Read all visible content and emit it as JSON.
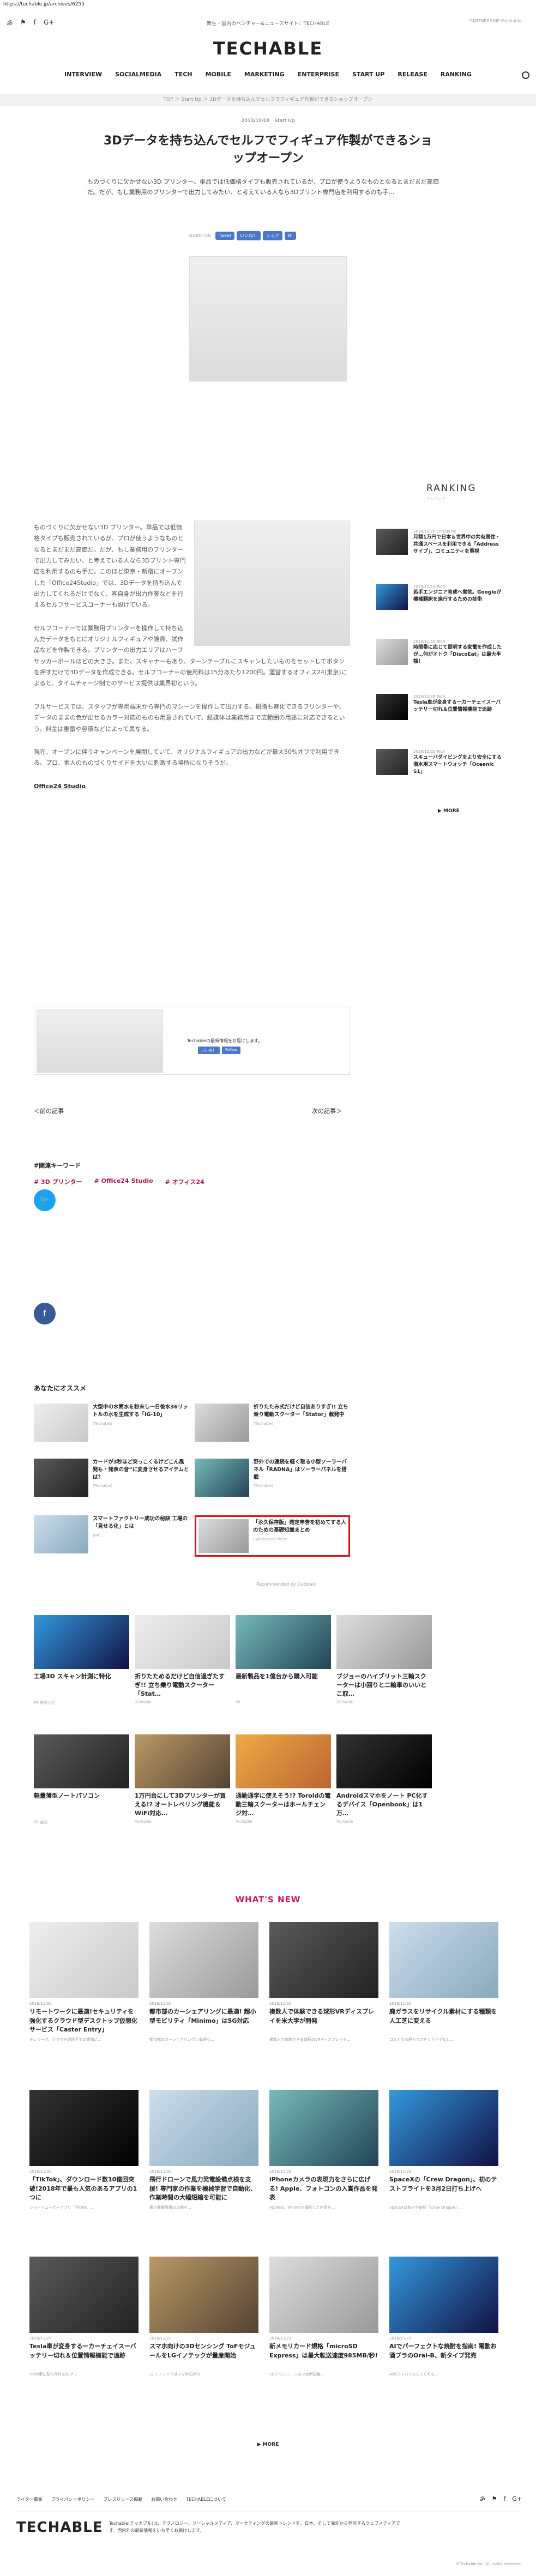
{
  "url": "https://techable.jp/archives/6255",
  "header": {
    "tagline": "新生・国内のベンチャー&ニュースサイト：TECHABLE",
    "partner": "PARTNERSHIP  Mashable",
    "logo": "TECHABLE",
    "social": [
      "ॐ",
      "⚑",
      "f",
      "G+"
    ],
    "nav": [
      "INTERVIEW",
      "SOCIALMEDIA",
      "TECH",
      "MOBILE",
      "MARKETING",
      "ENTERPRISE",
      "START UP",
      "RELEASE",
      "RANKING"
    ]
  },
  "breadcrumb": "TOP ＞ Start Up ＞ 3Dデータを持ち込んでセルフでフィギュア作製ができるショップオープン",
  "article": {
    "meta": "2013/10/18　Start Up",
    "title": "3Dデータを持ち込んでセルフでフィギュア作製ができるショップオープン",
    "lead": "ものづくりに欠かせない3D プリンター。単品では低価格タイプも販売されているが、プロが使うようなものとなるとまだまだ高価だ。だが、もし業務用のプリンターで出力してみたい、と考えている人なら3Dプリント専門店を利用するのも手…",
    "share_label": "SHARE ON",
    "share_buttons": [
      "Tweet",
      "いいね！",
      "シェア",
      "B!"
    ],
    "paragraphs": [
      "ものづくりに欠かせない3D プリンター。単品では低価格タイプも販売されているが、プロが使うようなものとなるとまだまだ高価だ。だが、もし業務用のプリンターで出力してみたい、と考えている人なら3Dプリント専門店を利用するのも手だ。このほど東京・新宿にオープンした「Office24Studio」では、3Dデータを持ち込んで出力してくれるだけでなく、客自身が出力作業などを行えるセルフサービスコーナーも設けている。",
      "セルフコーナーでは業務用プリンターを操作して持ち込んだデータをもとにオリジナルフィギュアや雑貨、試作品などを作製できる。プリンターの出力エリアはハーフサッカーボールほどの大きさ。また、スキャナーもあり、ターンテーブルにスキャンしたいものをセットしてボタンを押すだけで3Dデータを作成できる。セルフコーナーの使用料は15分あたり1200円。運営するオフィス24(東京)によると、タイムチャージ制でのサービス提供は業界初という。",
      "フルサービスでは、スタッフが専用端末から専門のマシーンを操作して出力する。樹脂も進化できるプリンターや、データのままの色が出せるカラー対応のものも用意されていて、紙媒体は業務用まで広範囲の用途に対応できるという。料金は重量や容積などによって異なる。",
      "現在、オープンに伴うキャンペーンを展開していて、オリジナルフィギュアの出力などが最大50%オフで利用できる。プロ、素人のものづくりサイドを大いに刺激する場所になりそうだ。"
    ],
    "tag": "Office24 Studio",
    "promo_text": "Techableの最新情報をお届けします。",
    "promo_buttons": [
      "いいね！",
      "Follow"
    ],
    "prev": "＜前の記事",
    "next": "次の記事＞"
  },
  "ranking": {
    "title": "RANKING",
    "sub": "ランキング",
    "items": [
      {
        "date": "2018/11/26 Enterprise",
        "title": "月額1万円で日本＆世界中の共有居住・共通スペースを利用できる「Addressサイプ」、コミュニティを重視"
      },
      {
        "date": "2018/11/19 Tech",
        "title": "若手エンジニア育成へ意欲。Googleが機械翻訳を進行するための技術"
      },
      {
        "date": "2018/11/26 Tech",
        "title": "時間帯に応じて照明する家電を作成したが…何がオトク「DiscoEat」は最大半額！"
      },
      {
        "date": "2018/11/29 Tech",
        "title": "Tesla車が変身する一カーチェイスーバッテリー切れ＆位置情報機能で追跡"
      },
      {
        "date": "2018/11/20 Tech",
        "title": "スキューバダイビングをより安全にする潜水用スマートウォッチ「Oceanic S1」"
      }
    ],
    "more": "▶ MORE"
  },
  "related": {
    "heading": "#関連キーワード",
    "keywords": [
      "# 3D プリンター",
      "# Office24 Studio",
      "# オフィス24"
    ]
  },
  "recommend": {
    "heading": "あなたにオススメ",
    "items": [
      {
        "title": "大型中の水筒水を粉末し一日後水36リットルの水を生成する「IG-10」",
        "src": "(Techable)"
      },
      {
        "title": "折りたたみ式だけど自信ありすぎ!! 立ち乗り電動スクーター「Stator」載発中",
        "src": "(Techable)"
      },
      {
        "title": "カードが3秒ほど突っこくるけどこん風発も・発表の音“に変身させるアイテムとは？",
        "src": "(Techable)"
      },
      {
        "title": "野外での連続を軽く取る小型ソーラーパネル「RADNA」はソーラーパネルを搭載",
        "src": "(Techable)"
      },
      {
        "title": "スマートファクトリー成功の秘訣 工場の「見せる化」とは",
        "src": "(PR) ..."
      },
      {
        "title": "「永久保存版」確定申告を初めてする人のための基礎知識まとめ",
        "src": "(Sponsored) freee"
      }
    ],
    "outbrain": "Recommended by Outbrain"
  },
  "grid": [
    {
      "title": "工場3D スキャン計測に特化",
      "src": "PR 株式会社"
    },
    {
      "title": "折りたためるだけど自信過ぎたすぎ!! 立ち乗り電動スクーター「Stat…",
      "src": "Techable"
    },
    {
      "title": "最新製品を1億台から購入可能",
      "src": "PR"
    },
    {
      "title": "ブジョーのハイブリット三輪スクーターは小回りと二輪車のいいとこ取…",
      "src": "Techable"
    },
    {
      "title": "軽量薄型ノートパソコン",
      "src": "PR 会社"
    },
    {
      "title": "1万円台にして3Dプリンターが買える!? オートレベリング機能＆WiFi対応…",
      "src": "Techable"
    },
    {
      "title": "通勤通学に使えそう!? Toroidの電動三輪スクーターはホールチェンジ対…",
      "src": "Techable"
    },
    {
      "title": "Androidスマホをノート PC化するデバイス「Openbook」は1万…",
      "src": "Techable"
    }
  ],
  "whats_new": {
    "heading": "WHAT'S NEW",
    "items": [
      {
        "date": "2018/11/30",
        "title": "リモートワークに最適!セキュリティを強化するクラウド型デスクトップ仮想化サービス「Caster Entry」",
        "desc": "テレワーク、クラウド環境下での業務に…"
      },
      {
        "date": "2018/11/30",
        "title": "都市部のカーシェアリングに最適! 超小型モビリティ「Minimo」は5G対応",
        "desc": "都市部のカーシェアリングに最適な…"
      },
      {
        "date": "2018/11/30",
        "title": "複数人で体験できる球形VRディスプレイを米大学が開発",
        "desc": "複数人で体験できる球形のVRディスプレイを…"
      },
      {
        "date": "2018/11/30",
        "title": "廃ガラスをリサイクル素材にする種類を人工芝に変える",
        "desc": "ゴミとなる廃ガラスをリサイクルし…"
      },
      {
        "date": "2018/11/30",
        "title": "「TikTok」、ダウンロード数10億回突破!2018年で最も人気のあるアプリの1つに",
        "desc": "ショートムービーアプリ「TikTok」…"
      },
      {
        "date": "2018/11/30",
        "title": "飛行ドローンで風力発電設備点検を支援! 専門家の作業を機械学習で自動化、作業時間の大幅短縮を可能に",
        "desc": "風力発電設備の点検を…"
      },
      {
        "date": "2018/11/29",
        "title": "iPhoneカメラの表現力をさらに広げる! Apple、フォトコンの入賞作品を発表",
        "desc": "Appleは、iPhoneで撮影した作品を…"
      },
      {
        "date": "2018/11/29",
        "title": "SpaceXの「Crew Dragon」、初のテストフライトを3月2日打ち上げへ",
        "desc": "SpaceXは有人宇宙船「Crew Dragon」…"
      },
      {
        "date": "2018/11/29",
        "title": "Tesla車が変身する一カーチェイスーバッテリー切れ＆位置情報機能で追跡",
        "desc": "Tesla車に取り付けるだけで…"
      },
      {
        "date": "2018/11/29",
        "title": "スマホ向けの3Dセンシング ToFモジュールをLGイノテックが量産開始",
        "desc": "LGイノテックはスマホ向けの…"
      },
      {
        "date": "2018/11/29",
        "title": "新メモリカード規格「microSD Express」は最大転送速度985MB/秒!",
        "desc": "SDアソシエーションは新規格…"
      },
      {
        "date": "2018/11/29",
        "title": "AIでパーフェクトな焼酎を指南! 電動お酒プラのOrai-B、新タイプ発売",
        "desc": "AIがアドバイスしてくれる…"
      }
    ],
    "more": "▶ MORE"
  },
  "footer": {
    "links": [
      "ライター募集",
      "プライバシーポリシー",
      "プレスリリース掲載",
      "お問い合わせ",
      "TECHABLEについて"
    ],
    "social": [
      "ॐ",
      "⚑",
      "f",
      "G+"
    ],
    "logo": "TECHABLE",
    "desc": "Techable(テッカブル)は、テクノロジー、ソーシャルメディア、マーケティングの最新トレンドを、日本、そして海外から発信するウェブメディアです。国内外の最新情報をいち早くお届けします。",
    "copyright": "©Techable Inc. All rights reserved."
  },
  "colors": {
    "accent": "#a01c56",
    "whatsnew": "#c2185b",
    "twitter": "#1da1f2",
    "facebook": "#3b5998",
    "ad_border": "#dd1111"
  }
}
